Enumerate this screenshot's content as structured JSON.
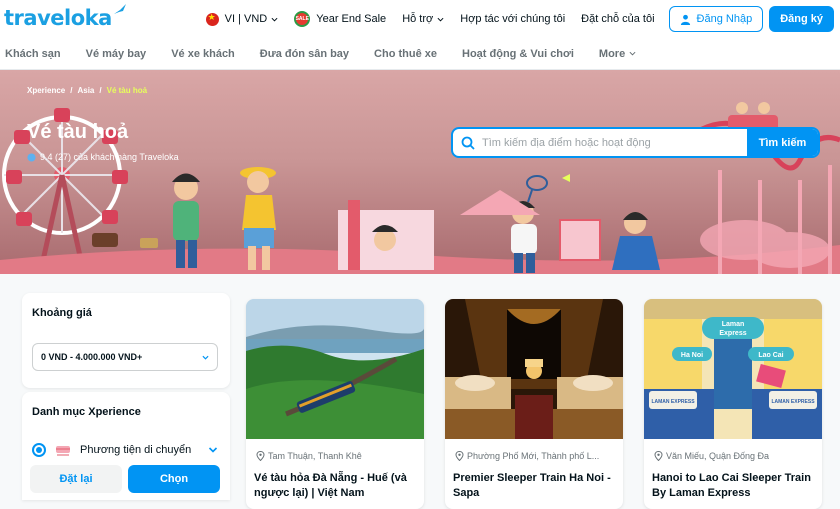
{
  "header": {
    "logo_text": "traveloka",
    "language_currency": "VI | VND",
    "sale_label": "Year End Sale",
    "help_label": "Hỗ trợ",
    "partner_label": "Hợp tác với chúng tôi",
    "bookings_label": "Đặt chỗ của tôi",
    "login_label": "Đăng Nhập",
    "signup_label": "Đăng ký"
  },
  "nav": {
    "items": [
      "Khách sạn",
      "Vé máy bay",
      "Vé xe khách",
      "Đưa đón sân bay",
      "Cho thuê xe",
      "Hoạt động & Vui chơi",
      "More"
    ]
  },
  "hero": {
    "breadcrumb": [
      "Xperience",
      "/",
      "Asia",
      "/",
      "Vé tàu hoả"
    ],
    "title": "Vé tàu hoả",
    "rating": "9.4 (27) của khách hàng Traveloka",
    "search_placeholder": "Tìm kiếm địa điểm hoặc hoạt động",
    "search_button": "Tìm kiếm"
  },
  "filters": {
    "price_title": "Khoảng giá",
    "price_value": "0 VND - 4.000.000 VND+",
    "category_title": "Danh mục Xperience",
    "category_item": "Phương tiện di chuyển",
    "reset_label": "Đặt lại",
    "choose_label": "Chọn"
  },
  "cards": [
    {
      "location": "Tam Thuận, Thanh Khê",
      "title": "Vé tàu hỏa Đà Nẵng - Huế (và ngược lại) | Việt Nam"
    },
    {
      "location": "Phường Phố Mới, Thành phố L...",
      "title": "Premier Sleeper Train Ha Noi - Sapa"
    },
    {
      "location": "Văn Miếu, Quận Đống Đa",
      "title": "Hanoi to Lao Cai Sleeper Train By Laman Express"
    }
  ],
  "card_image_labels": {
    "laman_express_line1": "Laman",
    "laman_express_line2": "Express",
    "ha_noi": "Ha Noi",
    "lao_cai": "Lao Cai",
    "pillow_brand": "LAMAN EXPRESS"
  },
  "colors": {
    "brand_blue": "#0194f3",
    "logo_blue": "#1ba0e2",
    "breadcrumb_active": "#e7ff5b"
  }
}
